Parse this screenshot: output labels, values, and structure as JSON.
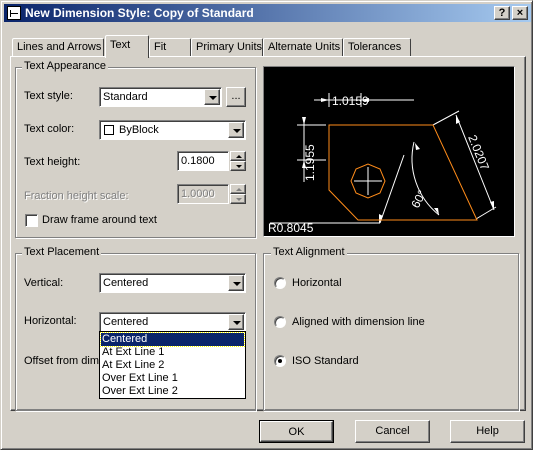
{
  "window": {
    "title": "New Dimension Style: Copy of Standard",
    "help_glyph": "?",
    "close_glyph": "×"
  },
  "tabs": [
    {
      "label": "Lines and Arrows"
    },
    {
      "label": "Text",
      "active": true
    },
    {
      "label": "Fit"
    },
    {
      "label": "Primary Units"
    },
    {
      "label": "Alternate Units"
    },
    {
      "label": "Tolerances"
    }
  ],
  "text_appearance": {
    "group_label": "Text Appearance",
    "style_label": "Text style:",
    "style_value": "Standard",
    "browse_label": "...",
    "color_label": "Text color:",
    "color_value": "ByBlock",
    "height_label": "Text height:",
    "height_value": "0.1800",
    "fraction_label": "Fraction height scale:",
    "fraction_value": "1.0000",
    "frame_label": "Draw frame around text",
    "frame_checked": false
  },
  "text_placement": {
    "group_label": "Text Placement",
    "vertical_label": "Vertical:",
    "vertical_value": "Centered",
    "horizontal_label": "Horizontal:",
    "horizontal_value": "Centered",
    "offset_label": "Offset from dim l",
    "dropdown_options": [
      "Centered",
      "At Ext Line 1",
      "At Ext Line 2",
      "Over Ext Line 1",
      "Over Ext Line 2"
    ],
    "dropdown_selected": "Centered"
  },
  "text_alignment": {
    "group_label": "Text Alignment",
    "options": [
      {
        "label": "Horizontal",
        "selected": false
      },
      {
        "label": "Aligned with dimension line",
        "selected": false
      },
      {
        "label": "ISO Standard",
        "selected": true
      }
    ]
  },
  "preview": {
    "dim_top": "1.0159",
    "dim_left": "1.1955",
    "dim_right": "2.0207",
    "dim_angle": "60°",
    "dim_radius": "R0.8045",
    "colors": {
      "background": "#000000",
      "geometry": "#ff8c1a",
      "dimension": "#ffffff"
    }
  },
  "buttons": {
    "ok": "OK",
    "cancel": "Cancel",
    "help": "Help"
  },
  "colors": {
    "face": "#d4d0c8",
    "title_start": "#0a246a",
    "title_end": "#a6caf0",
    "selection": "#0a246a"
  }
}
